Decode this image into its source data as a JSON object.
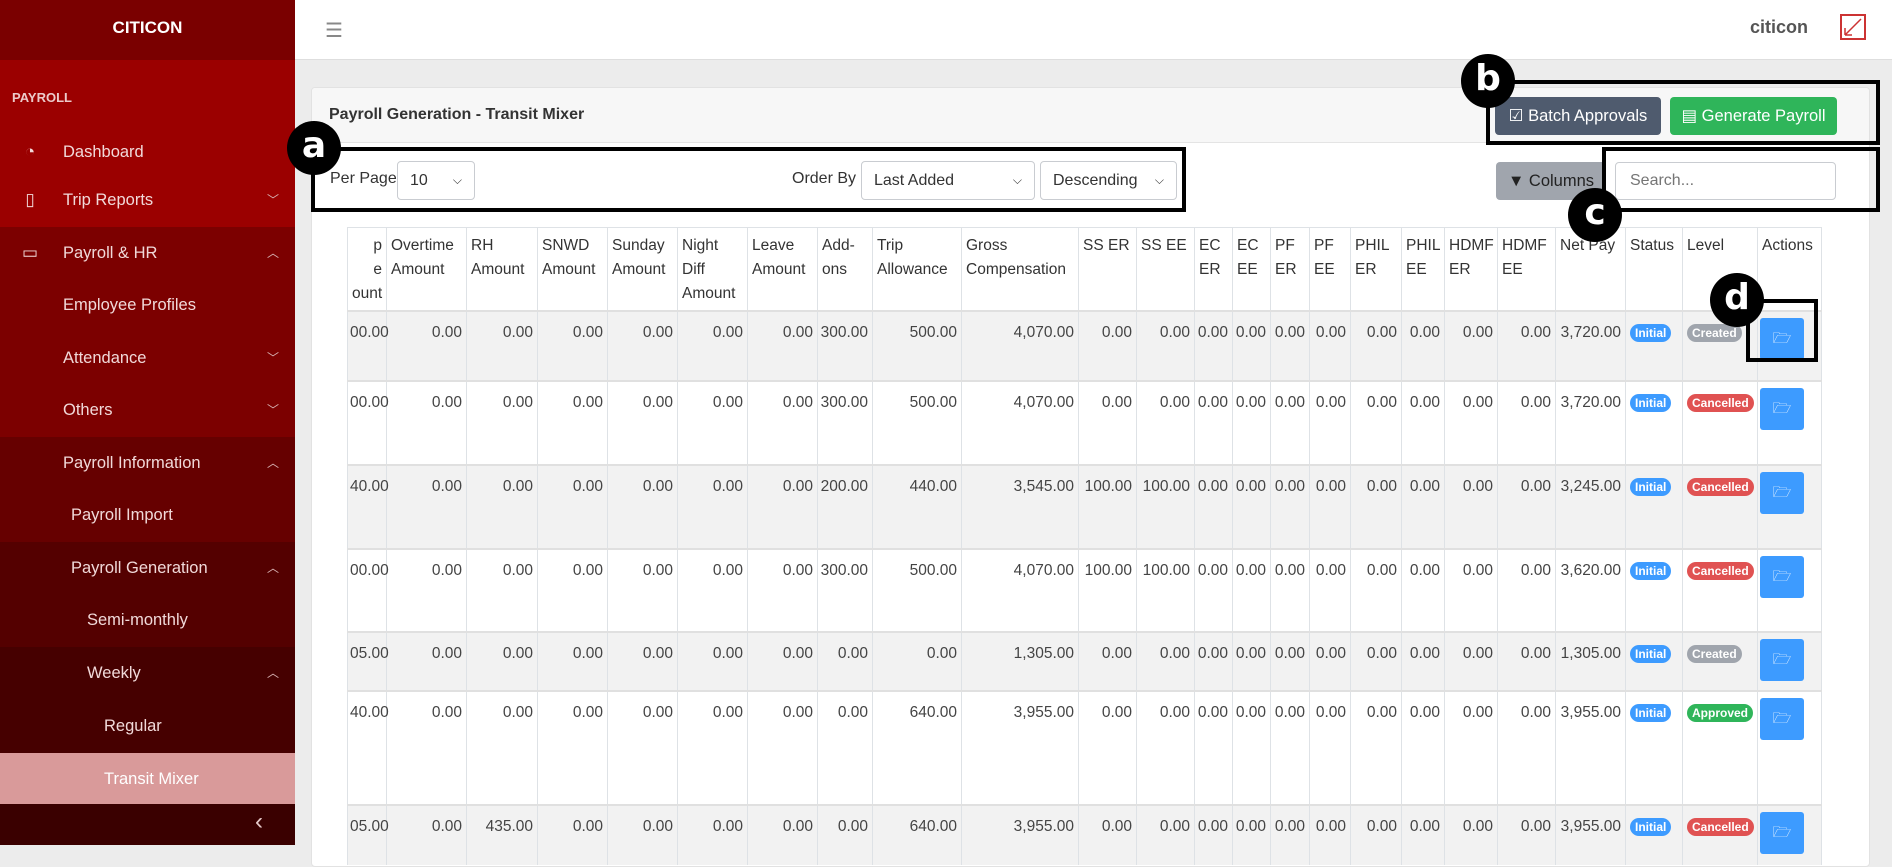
{
  "sidebar": {
    "brand": "CITICON",
    "section": "PAYROLL",
    "items": [
      {
        "label": "Dashboard",
        "icon": "dashboard-gauge-icon",
        "chev": ""
      },
      {
        "label": "Trip Reports",
        "icon": "document-icon",
        "chev": "down"
      },
      {
        "label": "Payroll & HR",
        "icon": "wallet-icon",
        "chev": "up"
      },
      {
        "label": "Employee Profiles",
        "chev": ""
      },
      {
        "label": "Attendance",
        "chev": "down"
      },
      {
        "label": "Others",
        "chev": "down"
      },
      {
        "label": "Payroll Information",
        "chev": "up"
      },
      {
        "label": "Payroll Import",
        "chev": ""
      },
      {
        "label": "Payroll Generation",
        "chev": "up"
      },
      {
        "label": "Semi-monthly",
        "chev": ""
      },
      {
        "label": "Weekly",
        "chev": "up"
      },
      {
        "label": "Regular",
        "chev": ""
      },
      {
        "label": "Transit Mixer",
        "chev": "",
        "active": true
      }
    ],
    "collapse_icon": "‹"
  },
  "header": {
    "user": "citicon"
  },
  "card": {
    "title": "Payroll Generation - Transit Mixer",
    "batch_label": "Batch Approvals",
    "generate_label": "Generate Payroll",
    "per_page_label": "Per Page",
    "per_page_value": "10",
    "order_by_label": "Order By",
    "order_by_value": "Last Added",
    "direction_value": "Descending",
    "columns_label": "Columns",
    "search_placeholder": "Search..."
  },
  "table": {
    "headers": [
      "p\ne\nount",
      "Overtime\nAmount",
      "RH\nAmount",
      "SNWD\nAmount",
      "Sunday\nAmount",
      "Night\nDiff\nAmount",
      "Leave\nAmount",
      "Add-\nons",
      "Trip\nAllowance",
      "Gross\nCompensation",
      "SS ER",
      "SS EE",
      "EC\nER",
      "EC\nEE",
      "PF\nER",
      "PF\nEE",
      "PHIL\nER",
      "PHIL\nEE",
      "HDMF\nER",
      "HDMF\nEE",
      "Net Pay",
      "Status",
      "Level",
      "Actions"
    ],
    "rows": [
      {
        "values": [
          "00.00",
          "0.00",
          "0.00",
          "0.00",
          "0.00",
          "0.00",
          "0.00",
          "300.00",
          "500.00",
          "4,070.00",
          "0.00",
          "0.00",
          "0.00",
          "0.00",
          "0.00",
          "0.00",
          "0.00",
          "0.00",
          "0.00",
          "0.00",
          "3,720.00"
        ],
        "status": "Initial",
        "level": "Created"
      },
      {
        "values": [
          "00.00",
          "0.00",
          "0.00",
          "0.00",
          "0.00",
          "0.00",
          "0.00",
          "300.00",
          "500.00",
          "4,070.00",
          "0.00",
          "0.00",
          "0.00",
          "0.00",
          "0.00",
          "0.00",
          "0.00",
          "0.00",
          "0.00",
          "0.00",
          "3,720.00"
        ],
        "status": "Initial",
        "level": "Cancelled"
      },
      {
        "values": [
          "40.00",
          "0.00",
          "0.00",
          "0.00",
          "0.00",
          "0.00",
          "0.00",
          "200.00",
          "440.00",
          "3,545.00",
          "100.00",
          "100.00",
          "0.00",
          "0.00",
          "0.00",
          "0.00",
          "0.00",
          "0.00",
          "0.00",
          "0.00",
          "3,245.00"
        ],
        "status": "Initial",
        "level": "Cancelled"
      },
      {
        "values": [
          "00.00",
          "0.00",
          "0.00",
          "0.00",
          "0.00",
          "0.00",
          "0.00",
          "300.00",
          "500.00",
          "4,070.00",
          "100.00",
          "100.00",
          "0.00",
          "0.00",
          "0.00",
          "0.00",
          "0.00",
          "0.00",
          "0.00",
          "0.00",
          "3,620.00"
        ],
        "status": "Initial",
        "level": "Cancelled"
      },
      {
        "values": [
          "05.00",
          "0.00",
          "0.00",
          "0.00",
          "0.00",
          "0.00",
          "0.00",
          "0.00",
          "0.00",
          "1,305.00",
          "0.00",
          "0.00",
          "0.00",
          "0.00",
          "0.00",
          "0.00",
          "0.00",
          "0.00",
          "0.00",
          "0.00",
          "1,305.00"
        ],
        "status": "Initial",
        "level": "Created"
      },
      {
        "values": [
          "40.00",
          "0.00",
          "0.00",
          "0.00",
          "0.00",
          "0.00",
          "0.00",
          "0.00",
          "640.00",
          "3,955.00",
          "0.00",
          "0.00",
          "0.00",
          "0.00",
          "0.00",
          "0.00",
          "0.00",
          "0.00",
          "0.00",
          "0.00",
          "3,955.00"
        ],
        "status": "Initial",
        "level": "Approved"
      },
      {
        "values": [
          "05.00",
          "0.00",
          "435.00",
          "0.00",
          "0.00",
          "0.00",
          "0.00",
          "0.00",
          "640.00",
          "3,955.00",
          "0.00",
          "0.00",
          "0.00",
          "0.00",
          "0.00",
          "0.00",
          "0.00",
          "0.00",
          "0.00",
          "0.00",
          "3,955.00"
        ],
        "status": "Initial",
        "level": "Cancelled"
      }
    ]
  },
  "colors": {
    "Initial": "#3d9bff",
    "Created": "#a0a5ad",
    "Cancelled": "#e05252",
    "Approved": "#2fb55a"
  },
  "annotations": [
    "a",
    "b",
    "c",
    "d"
  ]
}
